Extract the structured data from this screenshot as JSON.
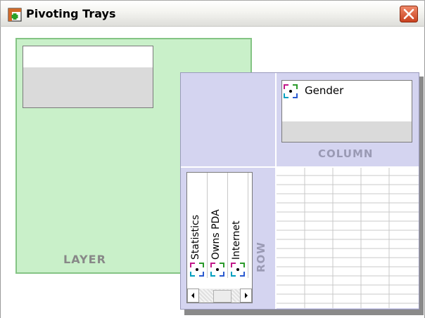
{
  "window": {
    "title": "Pivoting Trays",
    "accent": "#e05a3a",
    "icons": {
      "app": "pivot-table-icon",
      "close": "close-icon"
    }
  },
  "layer_panel": {
    "label": "LAYER",
    "background": "#c9f0c9"
  },
  "pivot_panel": {
    "background": "#d4d4f0",
    "column": {
      "label": "COLUMN",
      "items": [
        {
          "label": "Gender",
          "icon": "dimension-icon"
        }
      ]
    },
    "row": {
      "label": "ROW",
      "items": [
        {
          "label": "Statistics",
          "icon": "dimension-icon"
        },
        {
          "label": "Owns PDA",
          "icon": "dimension-icon"
        },
        {
          "label": "Internet",
          "icon": "dimension-icon"
        }
      ]
    }
  }
}
